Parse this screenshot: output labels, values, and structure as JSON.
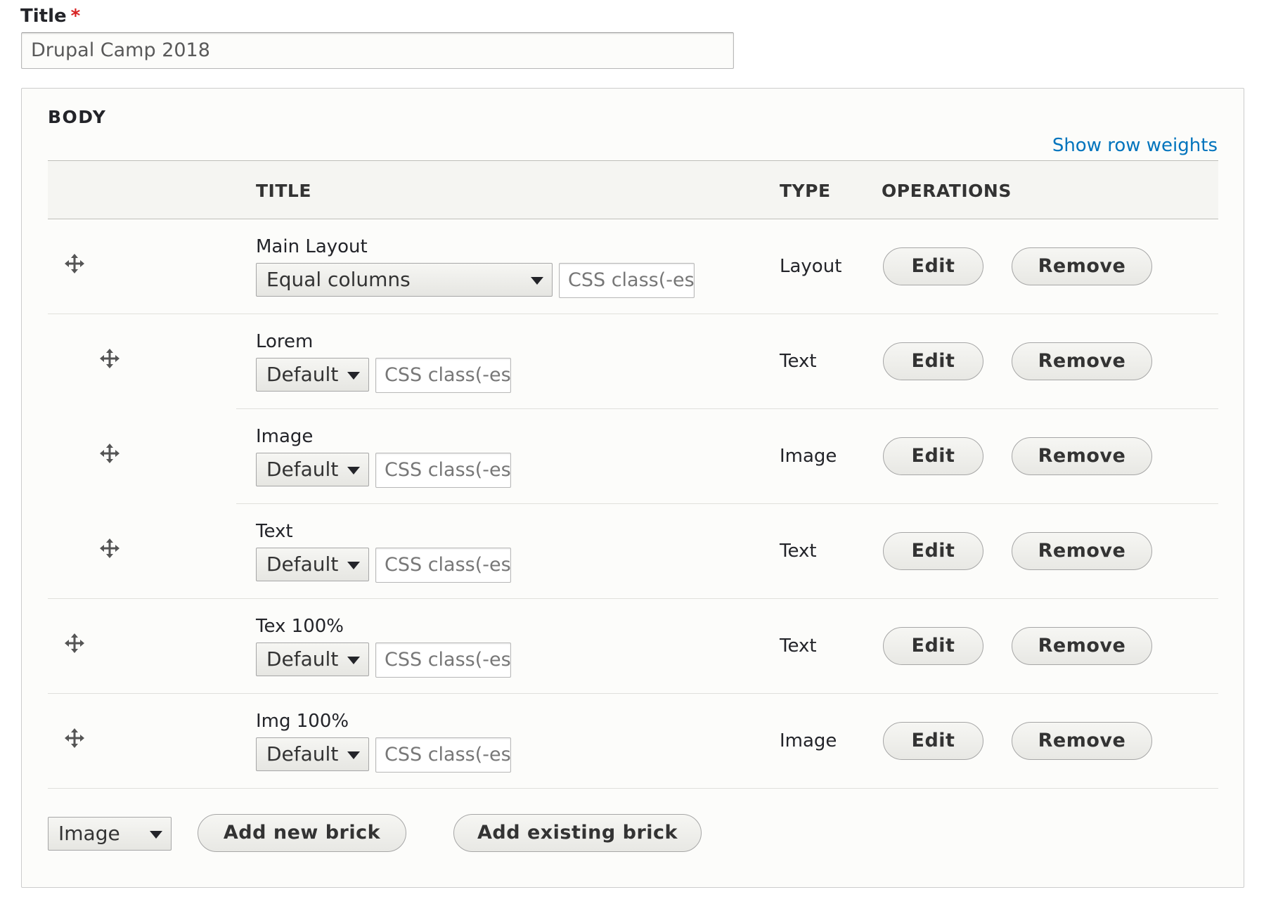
{
  "title_field": {
    "label": "Title",
    "required_marker": "*",
    "value": "Drupal Camp 2018"
  },
  "fieldset": {
    "legend": "BODY",
    "show_weights_link": "Show row weights",
    "columns": [
      "TITLE",
      "TYPE",
      "OPERATIONS"
    ],
    "rows": [
      {
        "title": "Main Layout",
        "select": "Equal columns",
        "css_placeholder": "CSS class(-es",
        "type": "Layout",
        "edit": "Edit",
        "remove": "Remove",
        "indent": 0
      },
      {
        "title": "Lorem",
        "select": "Default",
        "css_placeholder": "CSS class(-es",
        "type": "Text",
        "edit": "Edit",
        "remove": "Remove",
        "indent": 1
      },
      {
        "title": "Image",
        "select": "Default",
        "css_placeholder": "CSS class(-es",
        "type": "Image",
        "edit": "Edit",
        "remove": "Remove",
        "indent": 1
      },
      {
        "title": "Text",
        "select": "Default",
        "css_placeholder": "CSS class(-es",
        "type": "Text",
        "edit": "Edit",
        "remove": "Remove",
        "indent": 1
      },
      {
        "title": "Tex 100%",
        "select": "Default",
        "css_placeholder": "CSS class(-es",
        "type": "Text",
        "edit": "Edit",
        "remove": "Remove",
        "indent": 0
      },
      {
        "title": "Img 100%",
        "select": "Default",
        "css_placeholder": "CSS class(-es",
        "type": "Image",
        "edit": "Edit",
        "remove": "Remove",
        "indent": 0
      }
    ],
    "footer": {
      "type_select": "Image",
      "add_new_label": "Add new brick",
      "add_existing_label": "Add existing brick"
    }
  },
  "colors": {
    "link": "#0074bd",
    "required": "#d72222"
  },
  "icons": {
    "drag_handle": "move-arrows-icon",
    "select_arrow": "triangle-down-icon"
  }
}
